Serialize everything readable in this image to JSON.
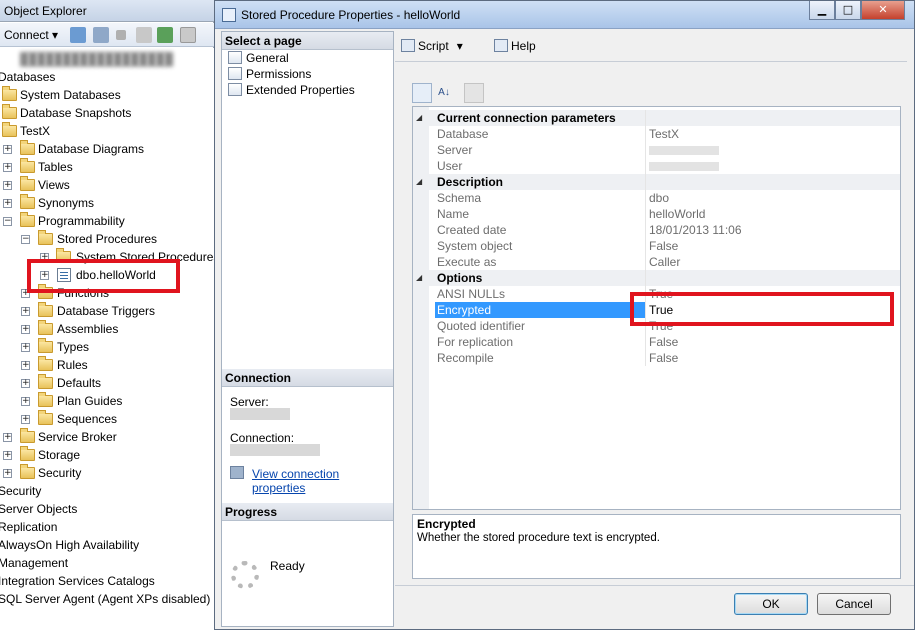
{
  "object_explorer": {
    "title": "Object Explorer",
    "connect_label": "Connect",
    "tree": [
      {
        "label": "Databases"
      },
      {
        "label": "System Databases"
      },
      {
        "label": "Database Snapshots"
      },
      {
        "label": "TestX"
      },
      {
        "label": "Database Diagrams"
      },
      {
        "label": "Tables"
      },
      {
        "label": "Views"
      },
      {
        "label": "Synonyms"
      },
      {
        "label": "Programmability"
      },
      {
        "label": "Stored Procedures"
      },
      {
        "label": "System Stored Procedures"
      },
      {
        "label": "dbo.helloWorld"
      },
      {
        "label": "Functions"
      },
      {
        "label": "Database Triggers"
      },
      {
        "label": "Assemblies"
      },
      {
        "label": "Types"
      },
      {
        "label": "Rules"
      },
      {
        "label": "Defaults"
      },
      {
        "label": "Plan Guides"
      },
      {
        "label": "Sequences"
      },
      {
        "label": "Service Broker"
      },
      {
        "label": "Storage"
      },
      {
        "label": "Security"
      },
      {
        "label": "Security"
      },
      {
        "label": "Server Objects"
      },
      {
        "label": "Replication"
      },
      {
        "label": "AlwaysOn High Availability"
      },
      {
        "label": "Management"
      },
      {
        "label": "Integration Services Catalogs"
      },
      {
        "label": "SQL Server Agent (Agent XPs disabled)"
      }
    ]
  },
  "dialog": {
    "title": "Stored Procedure Properties - helloWorld",
    "select_page_header": "Select a page",
    "pages": [
      "General",
      "Permissions",
      "Extended Properties"
    ],
    "connection_header": "Connection",
    "server_label": "Server:",
    "connection_label": "Connection:",
    "view_connection_link": "View connection properties",
    "progress_header": "Progress",
    "progress_status": "Ready",
    "script_label": "Script",
    "help_label": "Help",
    "grid": {
      "categories": [
        {
          "name": "Current connection parameters",
          "rows": [
            {
              "name": "Database",
              "value": "TestX"
            },
            {
              "name": "Server",
              "value": ""
            },
            {
              "name": "User",
              "value": ""
            }
          ]
        },
        {
          "name": "Description",
          "rows": [
            {
              "name": "Schema",
              "value": "dbo"
            },
            {
              "name": "Name",
              "value": "helloWorld"
            },
            {
              "name": "Created date",
              "value": "18/01/2013 11:06"
            },
            {
              "name": "System object",
              "value": "False"
            },
            {
              "name": "Execute as",
              "value": "Caller"
            }
          ]
        },
        {
          "name": "Options",
          "rows": [
            {
              "name": "ANSI NULLs",
              "value": "True"
            },
            {
              "name": "Encrypted",
              "value": "True"
            },
            {
              "name": "Quoted identifier",
              "value": "True"
            },
            {
              "name": "For replication",
              "value": "False"
            },
            {
              "name": "Recompile",
              "value": "False"
            }
          ]
        }
      ]
    },
    "description_title": "Encrypted",
    "description_text": "Whether the stored procedure text is encrypted.",
    "ok_label": "OK",
    "cancel_label": "Cancel"
  }
}
